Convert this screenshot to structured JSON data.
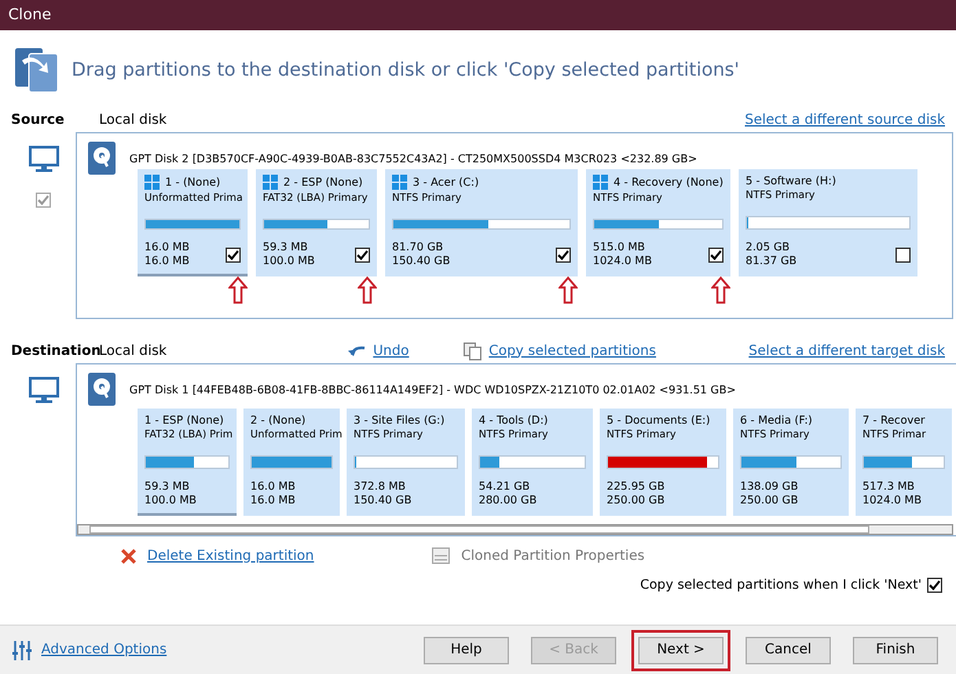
{
  "window": {
    "title": "Clone"
  },
  "instruction": "Drag partitions to the destination disk or click 'Copy selected partitions'",
  "source": {
    "label": "Source",
    "disk_type": "Local disk",
    "link": "Select a different source disk",
    "disk_checkbox": {
      "checked": true,
      "disabled": true
    },
    "disk": "GPT Disk 2 [D3B570CF-A90C-4939-B0AB-83C7552C43A2] - CT250MX500SSD4 M3CR023  <232.89 GB>",
    "partitions": [
      {
        "name": "1 -  (None)",
        "type": "Unformatted Prima",
        "windows": true,
        "level": 1.0,
        "used": "16.0 MB",
        "total": "16.0 MB",
        "checked": true,
        "marked": true,
        "selected": true
      },
      {
        "name": "2 - ESP (None)",
        "type": "FAT32 (LBA) Primary",
        "windows": true,
        "level": 0.6,
        "used": "59.3 MB",
        "total": "100.0 MB",
        "checked": true,
        "marked": true,
        "selected": false
      },
      {
        "name": "3 - Acer (C:)",
        "type": "NTFS Primary",
        "windows": true,
        "level": 0.54,
        "used": "81.70 GB",
        "total": "150.40 GB",
        "checked": true,
        "marked": true,
        "selected": false
      },
      {
        "name": "4 - Recovery (None)",
        "type": "NTFS Primary",
        "windows": true,
        "level": 0.5,
        "used": "515.0 MB",
        "total": "1024.0 MB",
        "checked": true,
        "marked": true,
        "selected": false
      },
      {
        "name": "5 - Software (H:)",
        "type": "NTFS Primary",
        "windows": false,
        "level": 0.01,
        "used": "2.05 GB",
        "total": "81.37 GB",
        "checked": false,
        "marked": false,
        "selected": false
      }
    ]
  },
  "destination": {
    "label": "Destination",
    "disk_type": "Local disk",
    "undo": "Undo",
    "copy": "Copy selected partitions",
    "link": "Select a different target disk",
    "disk": "GPT Disk 1 [44FEB48B-6B08-41FB-8BBC-86114A149EF2] - WDC WD10SPZX-21Z10T0 02.01A02  <931.51 GB>",
    "partitions": [
      {
        "name": "1 - ESP (None)",
        "type": "FAT32 (LBA) Prim",
        "level": 0.58,
        "color": "#2e9ad8",
        "used": "59.3 MB",
        "total": "100.0 MB",
        "selected": true
      },
      {
        "name": "2 -  (None)",
        "type": "Unformatted Prim",
        "level": 1.0,
        "color": "#2e9ad8",
        "used": "16.0 MB",
        "total": "16.0 MB",
        "selected": false
      },
      {
        "name": "3 - Site Files (G:)",
        "type": "NTFS Primary",
        "level": 0.01,
        "color": "#2e9ad8",
        "used": "372.8 MB",
        "total": "150.40 GB",
        "selected": false
      },
      {
        "name": "4 - Tools (D:)",
        "type": "NTFS Primary",
        "level": 0.18,
        "color": "#2e9ad8",
        "used": "54.21 GB",
        "total": "280.00 GB",
        "selected": false
      },
      {
        "name": "5 - Documents (E:)",
        "type": "NTFS Primary",
        "level": 0.9,
        "color": "#d40000",
        "used": "225.95 GB",
        "total": "250.00 GB",
        "selected": false
      },
      {
        "name": "6 - Media (F:)",
        "type": "NTFS Primary",
        "level": 0.55,
        "color": "#2e9ad8",
        "used": "138.09 GB",
        "total": "250.00 GB",
        "selected": false
      },
      {
        "name": "7 - Recover",
        "type": "NTFS Primar",
        "level": 0.6,
        "color": "#2e9ad8",
        "used": "517.3 MB",
        "total": "1024.0 MB",
        "selected": false
      }
    ]
  },
  "actions": {
    "delete": "Delete Existing partition",
    "properties": "Cloned Partition Properties"
  },
  "copy_on_next": {
    "label": "Copy selected partitions when I click 'Next'",
    "checked": true
  },
  "footer": {
    "advanced": "Advanced Options",
    "buttons": [
      {
        "label": "Help",
        "disabled": false,
        "highlighted": false
      },
      {
        "label": "< Back",
        "disabled": true,
        "highlighted": false
      },
      {
        "label": "Next >",
        "disabled": false,
        "highlighted": true
      },
      {
        "label": "Cancel",
        "disabled": false,
        "highlighted": false
      },
      {
        "label": "Finish",
        "disabled": false,
        "highlighted": false
      }
    ]
  }
}
